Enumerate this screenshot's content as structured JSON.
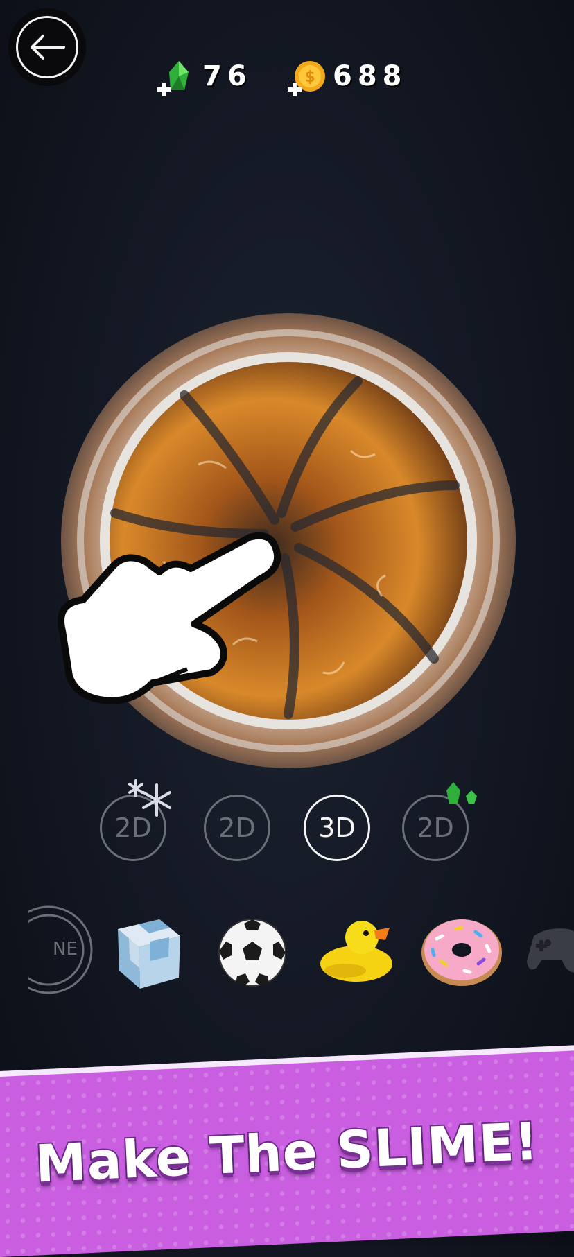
{
  "topbar": {
    "back_icon": "arrow-left-icon",
    "gems": {
      "icon": "green-gem-icon",
      "value": "76"
    },
    "coins": {
      "icon": "gold-coin-icon",
      "value": "688"
    }
  },
  "mode_selector": {
    "modes": [
      {
        "label": "2D",
        "decoration": "snowflake-icon",
        "active": false
      },
      {
        "label": "2D",
        "decoration": "",
        "active": false
      },
      {
        "label": "3D",
        "decoration": "",
        "active": true
      },
      {
        "label": "2D",
        "decoration": "green-gem-icon",
        "active": false
      }
    ]
  },
  "items_carousel": {
    "items": [
      {
        "name": "none-item",
        "label": "NE"
      },
      {
        "name": "cube-item"
      },
      {
        "name": "soccer-ball-item"
      },
      {
        "name": "rubber-duck-item"
      },
      {
        "name": "donut-item"
      },
      {
        "name": "gamepad-item"
      }
    ]
  },
  "banner": {
    "text": "Make The SLIME!"
  },
  "colors": {
    "background": "#121722",
    "banner": "#c95fe0",
    "slime_orange": "#d9892a",
    "active_mode": "#f4f4f4",
    "inactive_mode": "#6b6f78"
  }
}
